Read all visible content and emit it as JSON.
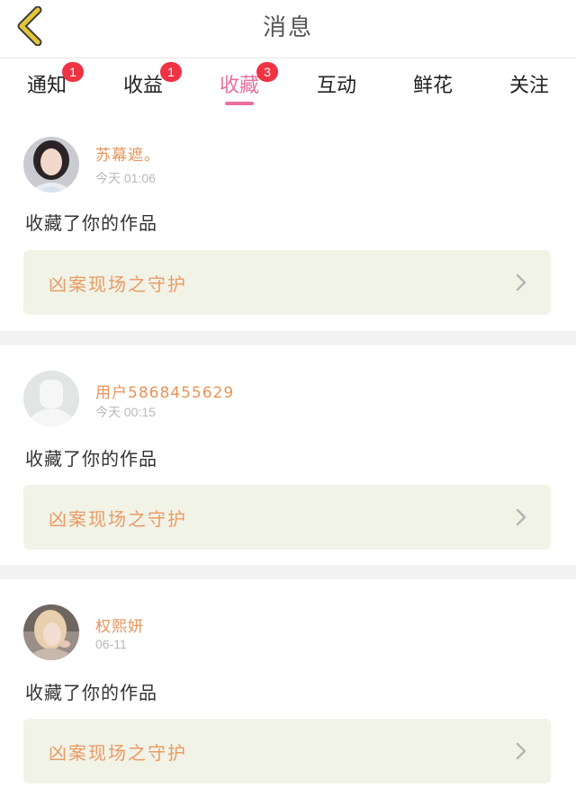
{
  "header": {
    "title": "消息"
  },
  "tabs": [
    {
      "label": "通知",
      "badge": "1",
      "active": false
    },
    {
      "label": "收益",
      "badge": "1",
      "active": false
    },
    {
      "label": "收藏",
      "badge": "3",
      "active": true
    },
    {
      "label": "互动",
      "badge": "",
      "active": false
    },
    {
      "label": "鲜花",
      "badge": "",
      "active": false
    },
    {
      "label": "关注",
      "badge": "",
      "active": false
    }
  ],
  "messages": [
    {
      "username": "苏幕遮。",
      "time": "今天 01:06",
      "action": "收藏了你的作品",
      "work_title": "凶案现场之守护",
      "avatar": "avatar-photo-woman-1"
    },
    {
      "username": "用户5868455629",
      "time": "今天 00:15",
      "action": "收藏了你的作品",
      "work_title": "凶案现场之守护",
      "avatar": "default-avatar-placeholder"
    },
    {
      "username": "权熙妍",
      "time": "06-11",
      "action": "收藏了你的作品",
      "work_title": "凶案现场之守护",
      "avatar": "avatar-photo-woman-2"
    }
  ],
  "colors": {
    "accent": "#ea6f9e",
    "badge": "#ee3344",
    "username": "#e8935a",
    "work_title": "#eb9a64",
    "work_bg": "#f1f3e7",
    "back_icon": "#e6c636"
  },
  "icons": {
    "back": "chevron-left-icon",
    "row_arrow": "chevron-right-icon"
  }
}
